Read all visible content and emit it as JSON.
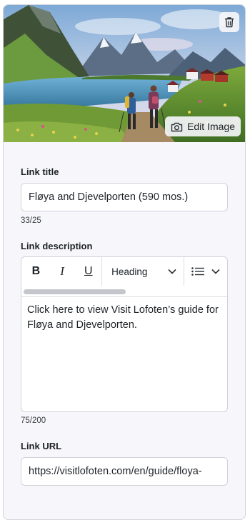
{
  "image": {
    "edit_label": "Edit Image",
    "icons": {
      "delete": "trash-icon",
      "edit": "camera-icon"
    }
  },
  "link_title": {
    "label": "Link title",
    "value": "Fløya and Djevelporten (590 mos.)",
    "counter": "33/25"
  },
  "link_description": {
    "label": "Link description",
    "toolbar": {
      "bold": "B",
      "italic": "I",
      "underline": "U",
      "heading_label": "Heading",
      "icons": [
        "bold-icon",
        "italic-icon",
        "underline-icon",
        "chevron-down-icon",
        "list-icon",
        "chevron-down-icon"
      ]
    },
    "value": "Click here to view Visit Lofoten’s guide for Fløya and Djevelporten.",
    "counter": "75/200"
  },
  "link_url": {
    "label": "Link URL",
    "value": "https://visitlofoten.com/en/guide/floya-"
  }
}
